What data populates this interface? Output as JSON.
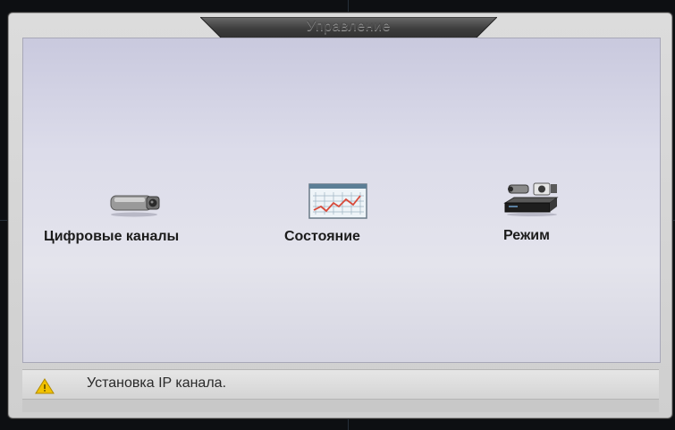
{
  "window": {
    "title": "Управление"
  },
  "menu": {
    "items": [
      {
        "label": "Цифровые каналы",
        "icon": "camera-icon"
      },
      {
        "label": "Состояние",
        "icon": "chart-icon"
      },
      {
        "label": "Режим",
        "icon": "devices-icon"
      }
    ]
  },
  "status": {
    "message": "Установка IP канала.",
    "icon": "warning-icon"
  },
  "colors": {
    "accent": "#f2c200",
    "chart_line": "#d84a3a",
    "panel": "#dcdcea"
  }
}
